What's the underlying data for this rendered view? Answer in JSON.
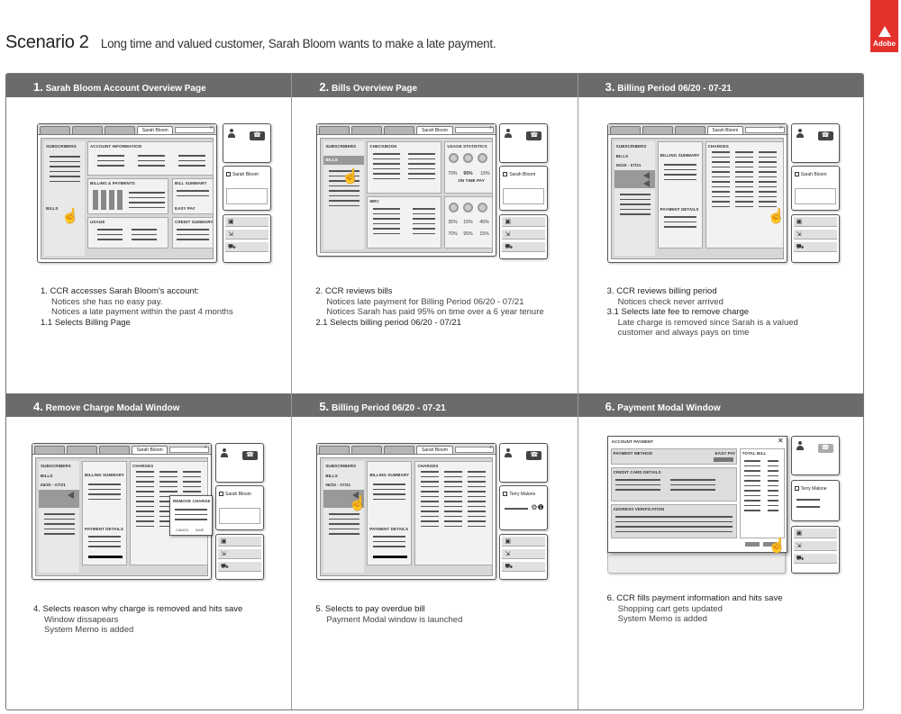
{
  "header": {
    "scenario": "Scenario 2",
    "subtitle": "Long time and valued customer, Sarah Bloom wants to make a late payment.",
    "logo_text": "Adobe"
  },
  "colors": {
    "brand": "#e4322b",
    "header_bar": "#6b6b6b"
  },
  "steps": [
    {
      "num": "1.",
      "title": "Sarah Bloom Account Overview Page",
      "desc": [
        {
          "text": "1. CCR accesses Sarah Bloom's account:",
          "kind": "main"
        },
        {
          "text": "Notices she has no easy pay.",
          "kind": "note"
        },
        {
          "text": "Notices a late payment within the past 4 months",
          "kind": "note"
        },
        {
          "text": "1.1 Selects Billing Page",
          "kind": "main"
        }
      ]
    },
    {
      "num": "2.",
      "title": "Bills Overview Page",
      "desc": [
        {
          "text": "2. CCR reviews bills",
          "kind": "main"
        },
        {
          "text": "Notices late payment for Billing Period 06/20 - 07/21",
          "kind": "note"
        },
        {
          "text": "Notices Sarah has  paid 95% on time over a 6 year tenure",
          "kind": "note"
        },
        {
          "text": "2.1 Selects billing period 06/20 - 07/21",
          "kind": "main"
        }
      ]
    },
    {
      "num": "3.",
      "title": "Billing Period 06/20 - 07-21",
      "desc": [
        {
          "text": "3. CCR reviews billing period",
          "kind": "main"
        },
        {
          "text": "Notices check never arrived",
          "kind": "note"
        },
        {
          "text": "3.1 Selects late fee to remove charge",
          "kind": "main"
        },
        {
          "text": "Late charge is removed since Sarah is a valued",
          "kind": "note"
        },
        {
          "text": "customer and always pays on time",
          "kind": "note"
        }
      ]
    },
    {
      "num": "4.",
      "title": "Remove Charge Modal Window",
      "desc": [
        {
          "text": "4. Selects reason why charge is removed and hits save",
          "kind": "main"
        },
        {
          "text": "Window dissapears",
          "kind": "note"
        },
        {
          "text": "System Memo is added",
          "kind": "note"
        }
      ]
    },
    {
      "num": "5.",
      "title": "Billing Period 06/20 - 07-21",
      "desc": [
        {
          "text": "5. Selects to pay overdue bill",
          "kind": "main"
        },
        {
          "text": "Payment Modal window is launched",
          "kind": "note"
        }
      ]
    },
    {
      "num": "6.",
      "title": "Payment Modal Window",
      "desc": [
        {
          "text": "6. CCR fills payment information and hits save",
          "kind": "main"
        },
        {
          "text": "Shopping cart gets updated",
          "kind": "note"
        },
        {
          "text": "System Memo is added",
          "kind": "note"
        }
      ]
    }
  ],
  "wireframe": {
    "tab_name": "Sarah Bloom",
    "customer_name": "Sarah Bloom",
    "customer_name_alt": "Terry Malone",
    "labels": {
      "subscribers": "SUBSCRIBERS",
      "bills": "BILLS",
      "account_info": "ACCOUNT INFORMATION",
      "billing_payments": "BILLING & PAYMENTS",
      "bill_summary": "BILL SUMMARY",
      "easy_pay": "EASY PAY",
      "usage": "USAGE",
      "credit_summary": "CREDIT SUMMARY",
      "checkbook": "CHECKBOOK",
      "usage_statistics": "USAGE STATISTICS",
      "mrc": "MRC",
      "on_time_pay": "ON TIME PAY",
      "period": "06/20 - 07/21",
      "billing_summary": "BILLING SUMMARY",
      "payment_details": "PAYMENT DETAILS",
      "charges": "CHARGES",
      "remove_charge": "REMOVE CHARGE",
      "account_payment": "ACCOUNT PAYMENT",
      "payment_method": "PAYMENT METHOD",
      "credit_card_details": "CREDIT CARD DETAILS",
      "address_verification": "ADDRESS VERIFICATION",
      "total_bill": "TOTAL BILL",
      "cancel": "CANCEL",
      "save": "SAVE"
    },
    "stats_top": [
      "70%",
      "95%",
      "15%"
    ],
    "stats_bottom": [
      "35%",
      "15%",
      "45%",
      "70%",
      "95%",
      "15%"
    ]
  }
}
